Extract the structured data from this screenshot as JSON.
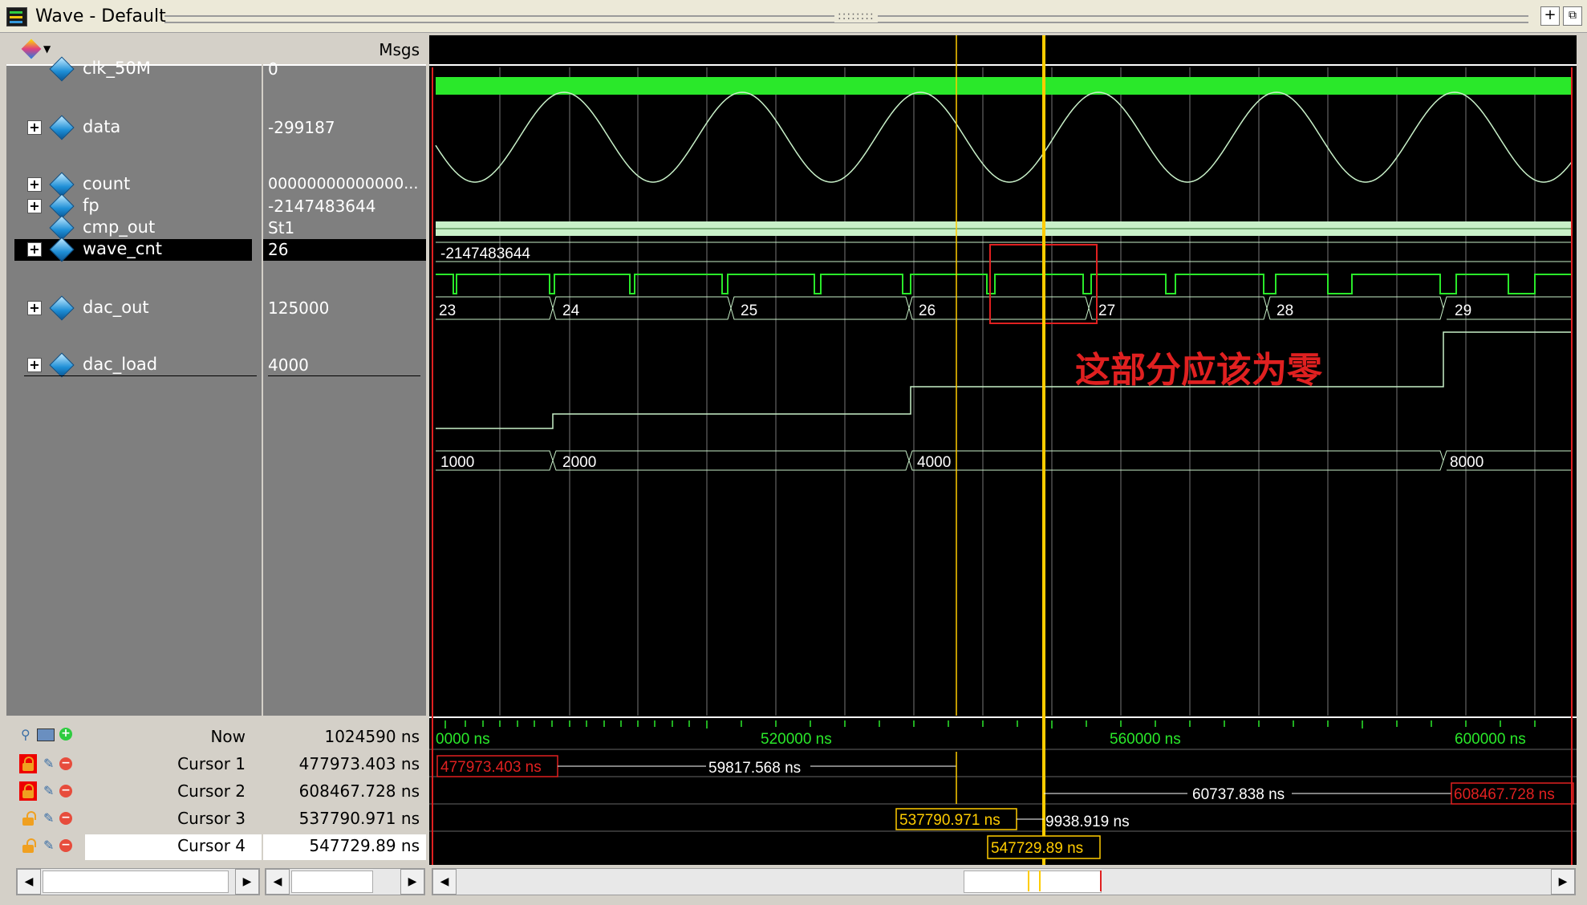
{
  "window": {
    "title": "Wave - Default",
    "btn_dock": "+",
    "btn_undock": "⧉"
  },
  "header": {
    "msgs_label": "Msgs"
  },
  "signals": [
    {
      "name": "clk_50M",
      "value": "0",
      "expandable": false
    },
    {
      "name": "data",
      "value": "-299187",
      "expandable": true
    },
    {
      "name": "count",
      "value": "00000000000000...",
      "expandable": true
    },
    {
      "name": "fp",
      "value": "-2147483644",
      "expandable": true
    },
    {
      "name": "cmp_out",
      "value": "St1",
      "expandable": false
    },
    {
      "name": "wave_cnt",
      "value": "26",
      "expandable": true,
      "selected": true
    },
    {
      "name": "dac_out",
      "value": "125000",
      "expandable": true
    },
    {
      "name": "dac_load",
      "value": "4000",
      "expandable": true
    }
  ],
  "wave_labels": {
    "fp": "-2147483644",
    "wave_cnt": [
      "23",
      "24",
      "25",
      "26",
      "27",
      "28",
      "29"
    ],
    "dac_load": [
      "1000",
      "2000",
      "4000",
      "8000"
    ]
  },
  "annotation": {
    "text": "这部分应该为零",
    "color": "#e02020"
  },
  "timeline": {
    "now_label": "Now",
    "now_value": "1024590 ns",
    "ticks": [
      "0000 ns",
      "520000 ns",
      "560000 ns",
      "600000 ns"
    ]
  },
  "cursors": [
    {
      "label": "Cursor 1",
      "value": "477973.403 ns",
      "locked": true
    },
    {
      "label": "Cursor 2",
      "value": "608467.728 ns",
      "locked": true
    },
    {
      "label": "Cursor 3",
      "value": "537790.971 ns",
      "locked": false
    },
    {
      "label": "Cursor 4",
      "value": "547729.89 ns",
      "locked": false
    }
  ],
  "cursor_readouts": {
    "c1_box": "477973.403 ns",
    "c1_c3_delta": "59817.568 ns",
    "c4_c2_delta": "60737.838 ns",
    "c2_box": "608467.728 ns",
    "c3_box": "537790.971 ns",
    "c3_c4_delta": "9938.919 ns",
    "c4_box": "547729.89 ns"
  },
  "colors": {
    "wave_green": "#2ae82a",
    "analog": "#c8f0c8",
    "cursor_active": "#ffcc00",
    "cursor_locked": "#e02020"
  }
}
